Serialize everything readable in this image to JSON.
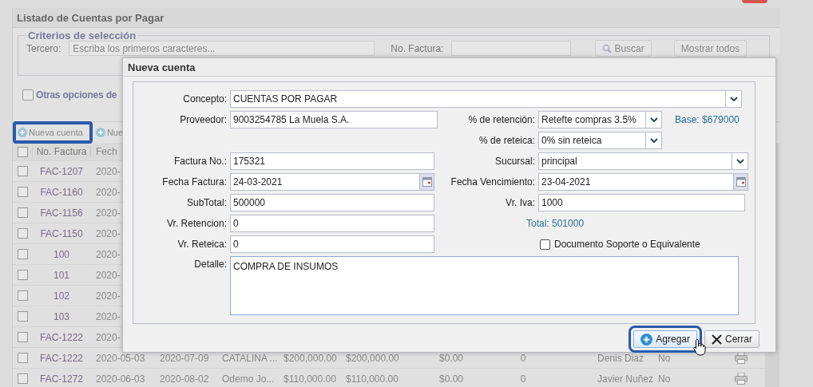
{
  "page_title": "Listado de Cuentas por Pagar",
  "criteria": {
    "legend": "Criterios de selección",
    "tercero_label": "Tercero:",
    "tercero_placeholder": "Escriba los primeros caracteres...",
    "factura_label": "No. Factura:",
    "search_button": "Buscar",
    "show_all_button": "Mostrar todos"
  },
  "other_options": {
    "label": "Otras opciones de",
    "checked": false
  },
  "toolbar": [
    {
      "label": "Nueva cuenta",
      "highlighted": true
    },
    {
      "label": "Nue",
      "highlighted": false
    }
  ],
  "table": {
    "header_checked": false,
    "columns": [
      "No. Factura",
      "Fech"
    ],
    "rows": [
      {
        "checked": false,
        "printable": false,
        "cells": [
          "FAC-1207",
          "2020-"
        ]
      },
      {
        "checked": false,
        "printable": false,
        "cells": [
          "FAC-1160",
          "2020-"
        ]
      },
      {
        "checked": false,
        "printable": false,
        "cells": [
          "FAC-1156",
          "2020-"
        ]
      },
      {
        "checked": false,
        "printable": false,
        "cells": [
          "FAC-1150",
          "2020-"
        ]
      },
      {
        "checked": false,
        "printable": false,
        "cells": [
          "100",
          "2020-"
        ]
      },
      {
        "checked": false,
        "printable": false,
        "cells": [
          "101",
          "2020-"
        ]
      },
      {
        "checked": false,
        "printable": false,
        "cells": [
          "102",
          "2020-"
        ]
      },
      {
        "checked": false,
        "printable": false,
        "cells": [
          "103",
          "2020-"
        ]
      },
      {
        "checked": false,
        "printable": false,
        "cells": [
          "FAC-1222",
          "2020-"
        ]
      },
      {
        "checked": false,
        "printable": true,
        "cells": [
          "FAC-1222",
          "2020-05-03",
          "2020-07-09",
          "CATALINA ...",
          "$200,000.00",
          "$200,000.00",
          "$0.00",
          "0",
          "Denis Diaz",
          "No"
        ]
      },
      {
        "checked": false,
        "printable": true,
        "cells": [
          "FAC-1272",
          "2020-06-03",
          "2020-08-02",
          "Odemo Jo...",
          "$110,000.00",
          "$110,000.00",
          "$0.00",
          "0",
          "Javier Nuñez",
          "No"
        ]
      }
    ]
  },
  "dialog": {
    "title": "Nueva cuenta",
    "concepto": {
      "label": "Concepto:",
      "value": "CUENTAS POR PAGAR"
    },
    "proveedor": {
      "label": "Proveedor:",
      "value": "9003254785 La Muela S.A."
    },
    "retencion": {
      "label": "% de retención:",
      "value": "Retefte compras 3.5%"
    },
    "base": "Base: $679000",
    "reteica": {
      "label": "% de reteica:",
      "value": "0% sin reteica"
    },
    "factura": {
      "label": "Factura No.:",
      "value": "175321"
    },
    "sucursal": {
      "label": "Sucursal:",
      "value": "principal"
    },
    "fecha_factura": {
      "label": "Fecha Factura:",
      "value": "24-03-2021"
    },
    "fecha_vencimiento": {
      "label": "Fecha Vencimiento:",
      "value": "23-04-2021"
    },
    "subtotal": {
      "label": "SubTotal:",
      "value": "500000"
    },
    "iva": {
      "label": "Vr. Iva:",
      "value": "1000"
    },
    "retencion_valor": {
      "label": "Vr. Retencion:",
      "value": "0"
    },
    "total": "Total: 501000",
    "reteica_valor": {
      "label": "Vr. Reteica:",
      "value": "0"
    },
    "documento_soporte": {
      "label": "Documento Soporte o Equivalente",
      "checked": false
    },
    "detalle": {
      "label": "Detalle:",
      "value": "COMPRA DE INSUMOS"
    },
    "buttons": [
      {
        "label": "Agregar",
        "kind": "add",
        "highlighted": true
      },
      {
        "label": "Cerrar",
        "kind": "close",
        "highlighted": false
      }
    ]
  }
}
